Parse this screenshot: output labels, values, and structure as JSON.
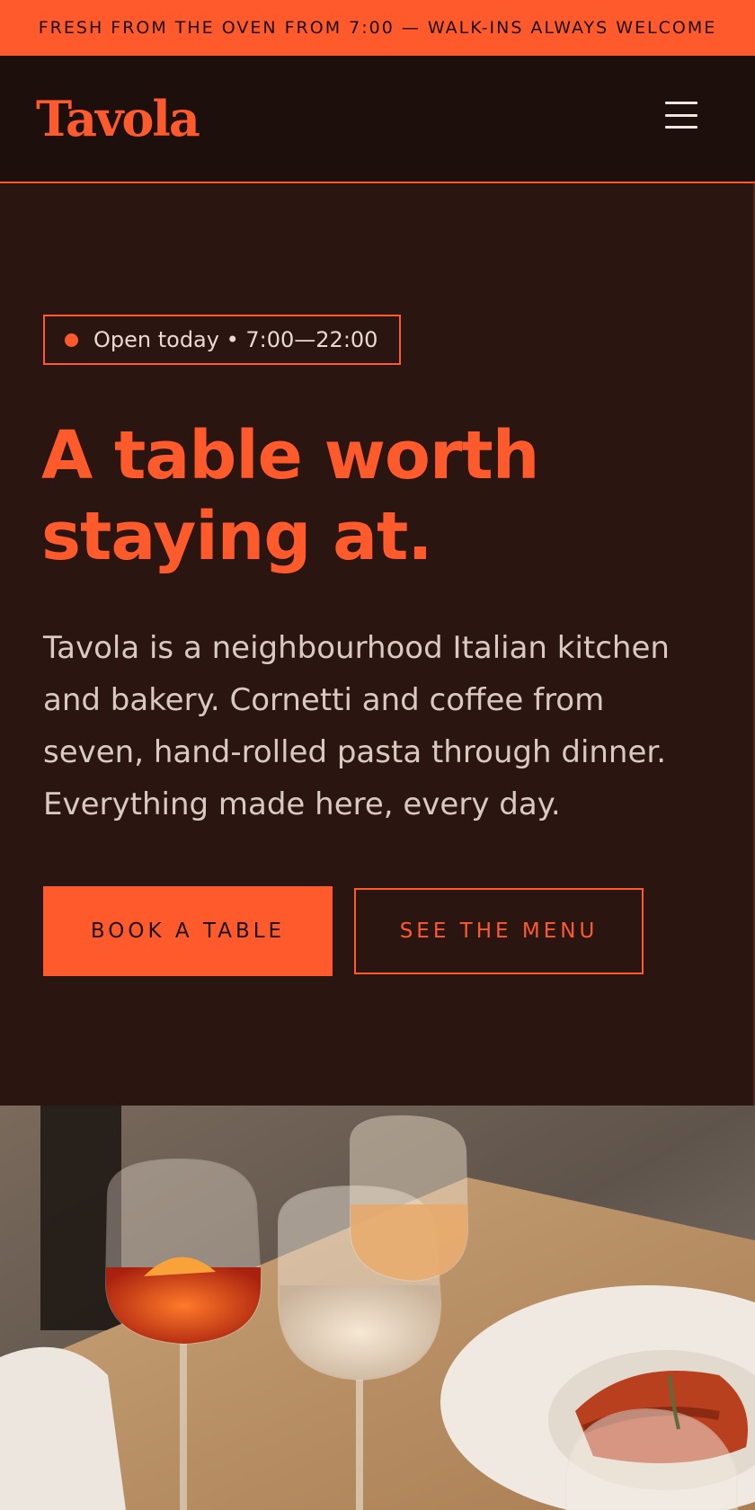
{
  "announcement": {
    "text": "FRESH FROM THE OVEN FROM 7:00 — WALK-INS ALWAYS WELCOME"
  },
  "header": {
    "logo": "Tavola",
    "menu_icon": "hamburger-menu-icon"
  },
  "hero": {
    "status": "Open today • 7:00—22:00",
    "headline_line1": "A table worth",
    "headline_line2": "staying at.",
    "body": "Tavola is a neighbourhood Italian kitchen and bakery. Cornetti and coffee from seven, hand-rolled pasta through dinner. Everything made here, every day.",
    "primary_button": "BOOK A TABLE",
    "secondary_button": "SEE THE MENU"
  },
  "colors": {
    "accent": "#ff5a2b",
    "background": "#2a1510",
    "header_background": "#1c0f0c",
    "text_light": "#d8c9c1"
  }
}
